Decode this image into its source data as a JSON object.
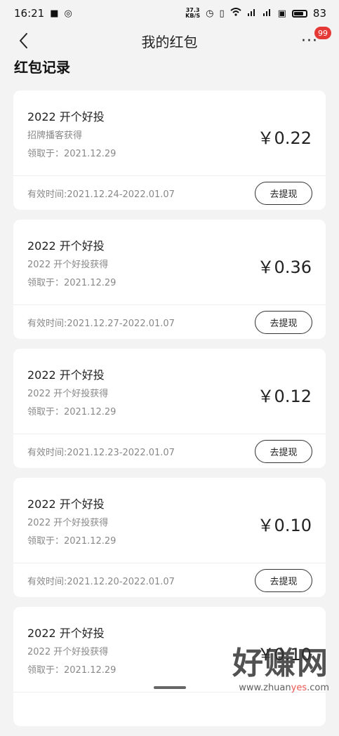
{
  "status_bar": {
    "time": "16:21",
    "net_speed_top": "37.3",
    "net_speed_bottom": "KB/S",
    "battery": "83",
    "battery_level": 0.83
  },
  "nav": {
    "title": "我的红包",
    "more": "···",
    "badge": "99"
  },
  "section_title": "红包记录",
  "cards": [
    {
      "title": "2022 开个好投",
      "source": "招牌播客获得",
      "date": "领取于：2021.12.29",
      "amount": "￥0.22",
      "valid": "有效时间:2021.12.24-2022.01.07",
      "button": "去提现"
    },
    {
      "title": "2022 开个好投",
      "source": "2022 开个好投获得",
      "date": "领取于：2021.12.29",
      "amount": "￥0.36",
      "valid": "有效时间:2021.12.27-2022.01.07",
      "button": "去提现"
    },
    {
      "title": "2022 开个好投",
      "source": "2022 开个好投获得",
      "date": "领取于：2021.12.29",
      "amount": "￥0.12",
      "valid": "有效时间:2021.12.23-2022.01.07",
      "button": "去提现"
    },
    {
      "title": "2022 开个好投",
      "source": "2022 开个好投获得",
      "date": "领取于：2021.12.29",
      "amount": "￥0.10",
      "valid": "有效时间:2021.12.20-2022.01.07",
      "button": "去提现"
    },
    {
      "title": "2022 开个好投",
      "source": "2022 开个好投获得",
      "date": "领取于：2021.12.29",
      "amount": "￥0.10",
      "valid": "",
      "button": ""
    }
  ],
  "watermark": {
    "main": "好赚网",
    "sub_prefix": "www.zhuan",
    "sub_red": "yes",
    "sub_suffix": ".com"
  }
}
